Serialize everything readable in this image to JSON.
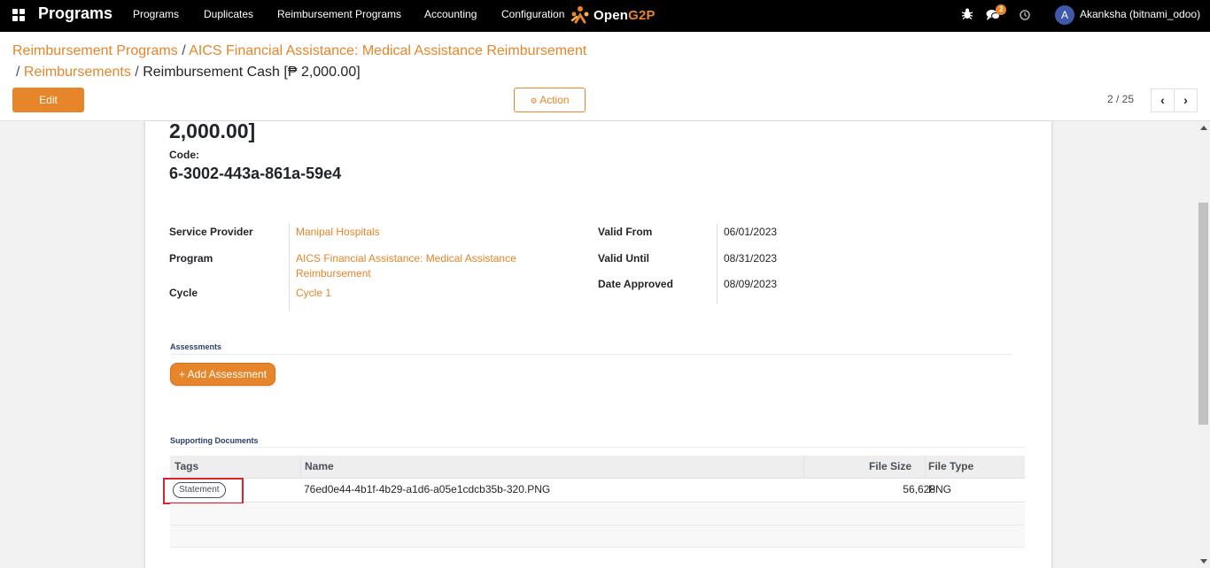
{
  "navbar": {
    "brand": "Programs",
    "menu": [
      "Programs",
      "Duplicates",
      "Reimbursement Programs",
      "Accounting",
      "Configuration"
    ],
    "logo_text_white": "Open",
    "logo_text_accent": "G2P",
    "notification_count": "2",
    "user_initial": "A",
    "user_name": "Akanksha (bitnami_odoo)"
  },
  "breadcrumb": {
    "item1": "Reimbursement Programs",
    "item2": "AICS Financial Assistance: Medical Assistance Reimbursement",
    "item3": "Reimbursements",
    "current": "Reimbursement Cash [₱ 2,000.00]",
    "sep": "/"
  },
  "toolbar": {
    "edit_label": "Edit",
    "action_icon": "⚙",
    "action_label": "Action",
    "pager": "2 / 25",
    "prev": "‹",
    "next": "›"
  },
  "record": {
    "title_tail": "2,000.00]",
    "code_label": "Code:",
    "code_value": "6-3002-443a-861a-59e4"
  },
  "fields_left": {
    "service_provider_label": "Service Provider",
    "service_provider_value": "Manipal Hospitals",
    "program_label": "Program",
    "program_value": "AICS Financial Assistance: Medical Assistance Reimbursement",
    "cycle_label": "Cycle",
    "cycle_value": "Cycle 1"
  },
  "fields_right": {
    "valid_from_label": "Valid From",
    "valid_from_value": "06/01/2023",
    "valid_until_label": "Valid Until",
    "valid_until_value": "08/31/2023",
    "date_approved_label": "Date Approved",
    "date_approved_value": "08/09/2023"
  },
  "assessments": {
    "title": "Assessments",
    "add_button": "+ Add Assessment"
  },
  "documents": {
    "title": "Supporting Documents",
    "columns": [
      "Tags",
      "Name",
      "File Size",
      "File Type"
    ],
    "rows": [
      {
        "tag": "Statement",
        "name": "76ed0e44-4b1f-4b29-a1d6-a05e1cdcb35b-320.PNG",
        "size": "56,628",
        "type": "PNG"
      }
    ]
  },
  "colors": {
    "accent": "#e6852a",
    "navbar_bg": "#000000",
    "highlight": "#e0202a"
  }
}
